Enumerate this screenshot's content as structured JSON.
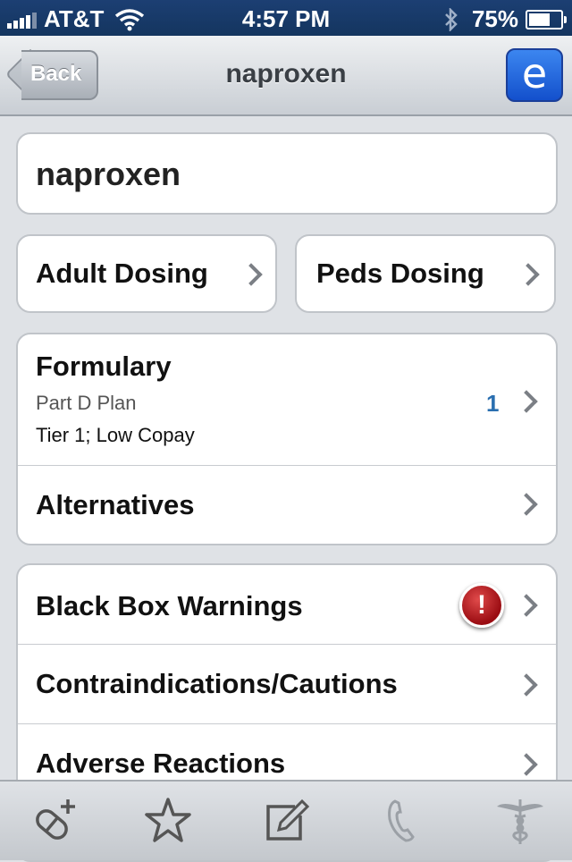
{
  "status": {
    "carrier": "AT&T",
    "time": "4:57 PM",
    "battery": "75%",
    "battery_level": 0.75
  },
  "nav": {
    "back_label": "Back",
    "title": "naproxen",
    "e_label": "e"
  },
  "drug": {
    "name": "naproxen"
  },
  "dosing": {
    "adult": "Adult Dosing",
    "peds": "Peds Dosing"
  },
  "formulary": {
    "title": "Formulary",
    "plan": "Part D Plan",
    "tier": "Tier 1; Low Copay",
    "count": "1"
  },
  "alternatives": {
    "label": "Alternatives"
  },
  "sections": {
    "black_box": "Black Box Warnings",
    "alert_symbol": "!",
    "contraindications": "Contraindications/Cautions",
    "adverse": "Adverse Reactions"
  },
  "tabbar": {
    "icons": [
      "pill-add-icon",
      "star-icon",
      "edit-icon",
      "phone-icon",
      "caduceus-icon"
    ]
  }
}
